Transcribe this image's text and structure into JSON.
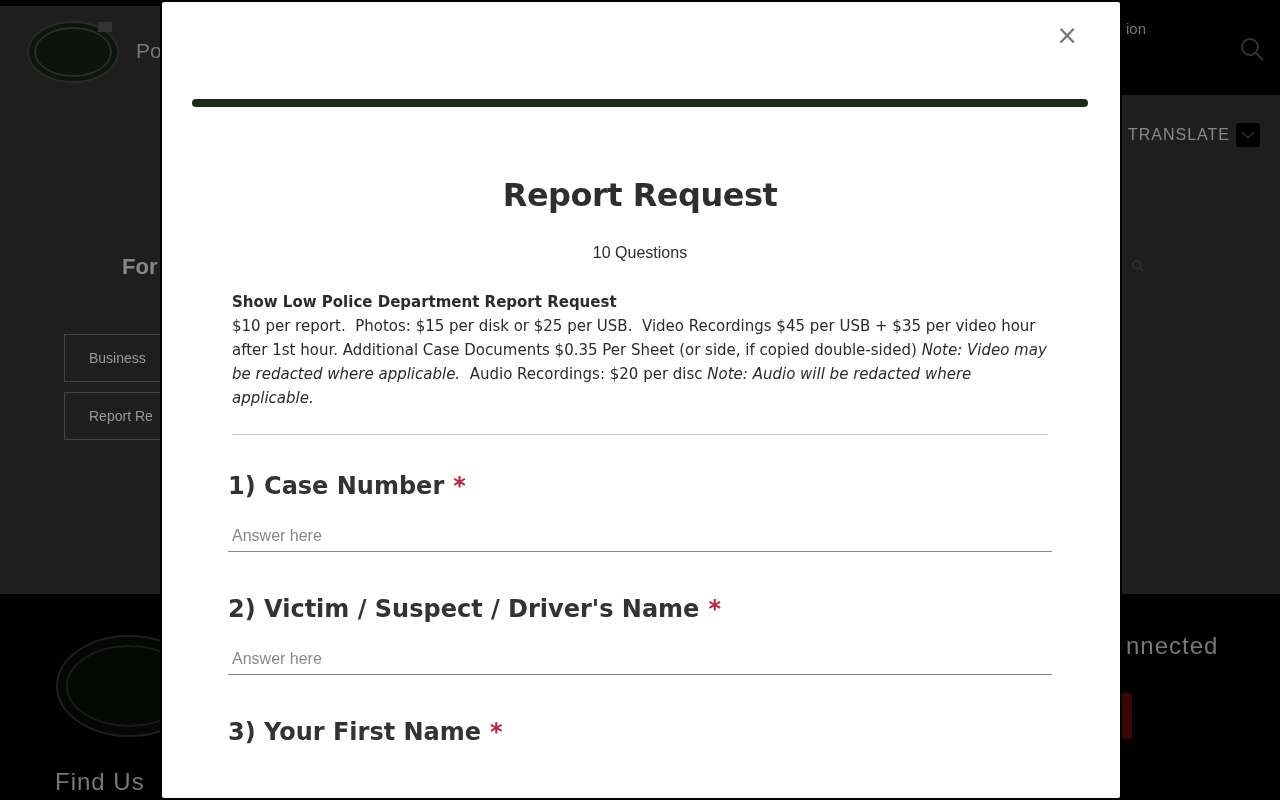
{
  "background_page": {
    "header": {
      "site_title": "Po",
      "nav_link": "ion",
      "translate": "TRANSLATE"
    },
    "content": {
      "heading": "For",
      "links": [
        "Business",
        "Report Re"
      ]
    },
    "footer": {
      "connect_heading": "nnected",
      "find_us": "Find Us"
    }
  },
  "modal": {
    "close": "×",
    "title": "Report Request",
    "question_count": "10 Questions",
    "description": {
      "heading": "Show Low Police Department Report Request",
      "text": "$10 per report.  Photos: $15 per disk or $25 per USB.  Video Recordings $45 per USB + $35 per video hour after 1st hour. Additional Case Documents $0.35 Per Sheet (or side, if copied double-sided) *Note: Video may be redacted where applicable.*  Audio Recordings: $20 per disc *Note: Audio will be redacted where applicable.*"
    },
    "questions": [
      {
        "label": "1) Case Number",
        "required_mark": "*",
        "placeholder": "Answer here"
      },
      {
        "label": "2) Victim / Suspect / Driver's Name",
        "required_mark": "*",
        "placeholder": "Answer here"
      },
      {
        "label": "3) Your First Name",
        "required_mark": "*"
      }
    ]
  }
}
